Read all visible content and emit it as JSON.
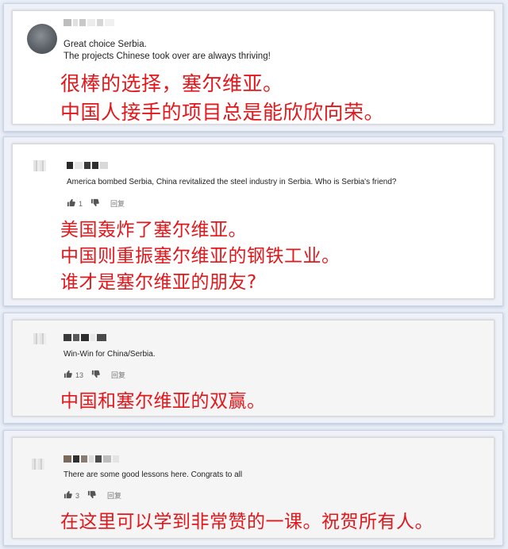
{
  "comments": [
    {
      "english_lines": [
        "Great choice Serbia.",
        "The projects Chinese took over are always thriving!"
      ],
      "chinese_lines": [
        "很棒的选择，塞尔维亚。",
        "中国人接手的项目总是能欣欣向荣。"
      ]
    },
    {
      "english": "America bombed Serbia, China revitalized the steel industry in Serbia. Who is Serbia's friend?",
      "likes": "1",
      "reply_label": "回复",
      "chinese_lines": [
        "美国轰炸了塞尔维亚。",
        "中国则重振塞尔维亚的钢铁工业。",
        "谁才是塞尔维亚的朋友?"
      ]
    },
    {
      "english": "Win-Win for China/Serbia.",
      "likes": "13",
      "reply_label": "回复",
      "chinese_lines": [
        "中国和塞尔维亚的双赢。"
      ]
    },
    {
      "english": "There are some good lessons here.  Congrats to all",
      "likes": "3",
      "reply_label": "回复",
      "chinese_lines": [
        "在这里可以学到非常赞的一课。祝贺所有人。"
      ]
    }
  ],
  "icons": {
    "avatar": "user-avatar",
    "like": "thumbs-up-icon",
    "dislike": "thumbs-down-icon"
  }
}
